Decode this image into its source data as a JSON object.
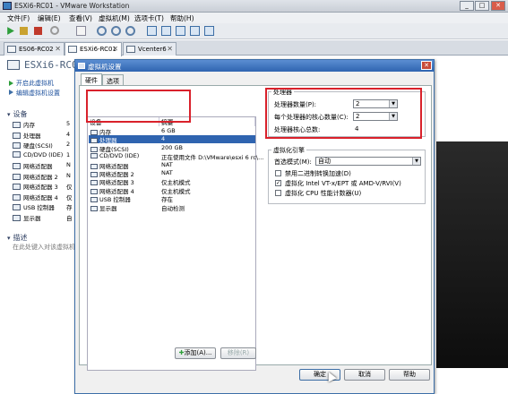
{
  "window": {
    "title": "ESXi6-RC01 - VMware Workstation",
    "min": "_",
    "max": "□",
    "close": "✕"
  },
  "menu": [
    "文件(F)",
    "编辑(E)",
    "查看(V)",
    "虚拟机(M)",
    "选项卡(T)",
    "帮助(H)"
  ],
  "tabs": [
    {
      "label": "ES06-RC02",
      "close": "✕"
    },
    {
      "label": "ESXi6-RC01",
      "close": "✕"
    },
    {
      "label": "Vcenter6",
      "close": "✕"
    }
  ],
  "vm": {
    "name": "ESXi6-RC01"
  },
  "left": {
    "power_on": "开启此虚拟机",
    "edit_settings": "编辑虚拟机设置",
    "devices_header": "设备",
    "devices": [
      {
        "name": "内存",
        "value": "5"
      },
      {
        "name": "处理器",
        "value": "4"
      },
      {
        "name": "硬盘(SCSI)",
        "value": "2"
      },
      {
        "name": "CD/DVD (IDE)",
        "value": "1"
      },
      {
        "name": "网络适配器",
        "value": "N"
      },
      {
        "name": "网络适配器 2",
        "value": "N"
      },
      {
        "name": "网络适配器 3",
        "value": "仅"
      },
      {
        "name": "网络适配器 4",
        "value": "仅"
      },
      {
        "name": "USB 控制器",
        "value": "存"
      },
      {
        "name": "显示器",
        "value": "自"
      }
    ],
    "desc_header": "描述",
    "desc_placeholder": "在此处键入对该虚拟机的"
  },
  "dialog": {
    "title": "虚拟机设置",
    "close": "✕",
    "tabs": [
      "硬件",
      "选项"
    ],
    "table_headers": [
      "设备",
      "摘要"
    ],
    "devices": [
      {
        "name": "内存",
        "summary": "6 GB"
      },
      {
        "name": "处理器",
        "summary": "4"
      },
      {
        "name": "硬盘(SCSI)",
        "summary": "200 GB"
      },
      {
        "name": "CD/DVD (IDE)",
        "summary": "正在使用文件 D:\\VMware\\esxi 6 rc\\..."
      },
      {
        "name": "网络适配器",
        "summary": "NAT"
      },
      {
        "name": "网络适配器 2",
        "summary": "NAT"
      },
      {
        "name": "网络适配器 3",
        "summary": "仅主机模式"
      },
      {
        "name": "网络适配器 4",
        "summary": "仅主机模式"
      },
      {
        "name": "USB 控制器",
        "summary": "存在"
      },
      {
        "name": "显示器",
        "summary": "自动检测"
      }
    ],
    "selected_index": 1,
    "add_button": "添加(A)...",
    "remove_button": "移除(R)",
    "processor": {
      "group_label": "处理器",
      "count_label": "处理器数量(P):",
      "count_value": "2",
      "cores_label": "每个处理器的核心数量(C):",
      "cores_value": "2",
      "total_label": "处理器核心总数:",
      "total_value": "4"
    },
    "virt": {
      "group_label": "虚拟化引擎",
      "mode_label": "首选模式(M):",
      "mode_value": "自动",
      "opt1": "禁用二进制转换加速(D)",
      "opt2": "虚拟化 Intel VT-x/EPT 或 AMD-V/RVI(V)",
      "opt3": "虚拟化 CPU 性能计数器(U)",
      "opt1_checked": false,
      "opt2_checked": true,
      "opt3_checked": false
    },
    "ok": "确定",
    "cancel": "取消",
    "help": "帮助"
  }
}
